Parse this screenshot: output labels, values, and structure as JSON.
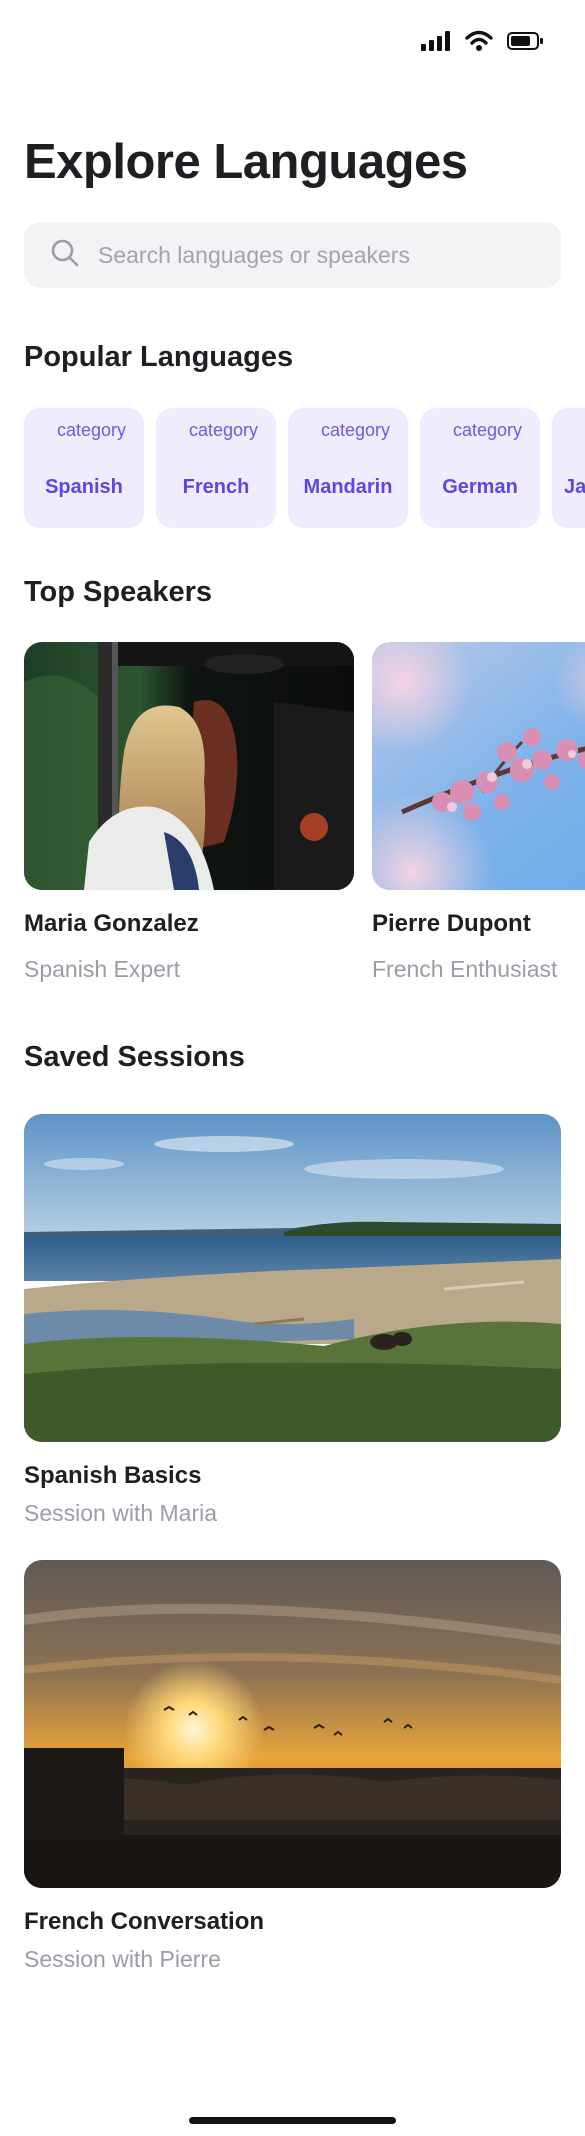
{
  "status_bar": {
    "icons": [
      "signal-icon",
      "wifi-icon",
      "battery-icon"
    ]
  },
  "header": {
    "title": "Explore Languages"
  },
  "search": {
    "placeholder": "Search languages or speakers",
    "icon": "search-icon"
  },
  "popular": {
    "title": "Popular Languages",
    "icon_alt_text": "category",
    "items": [
      {
        "label": "Spanish"
      },
      {
        "label": "French"
      },
      {
        "label": "Mandarin"
      },
      {
        "label": "German"
      },
      {
        "label": "Ja"
      }
    ]
  },
  "speakers": {
    "title": "Top Speakers",
    "items": [
      {
        "name": "Maria Gonzalez",
        "role": "Spanish Expert"
      },
      {
        "name": "Pierre Dupont",
        "role": "French Enthusiast"
      }
    ]
  },
  "sessions": {
    "title": "Saved Sessions",
    "items": [
      {
        "title": "Spanish Basics",
        "subtitle": "Session with Maria"
      },
      {
        "title": "French Conversation",
        "subtitle": "Session with Pierre"
      }
    ]
  },
  "colors": {
    "accent": "#5b48e2",
    "chip_bg": "#efedfd",
    "muted": "#9c9ca6",
    "search_bg": "#f3f3f6"
  }
}
